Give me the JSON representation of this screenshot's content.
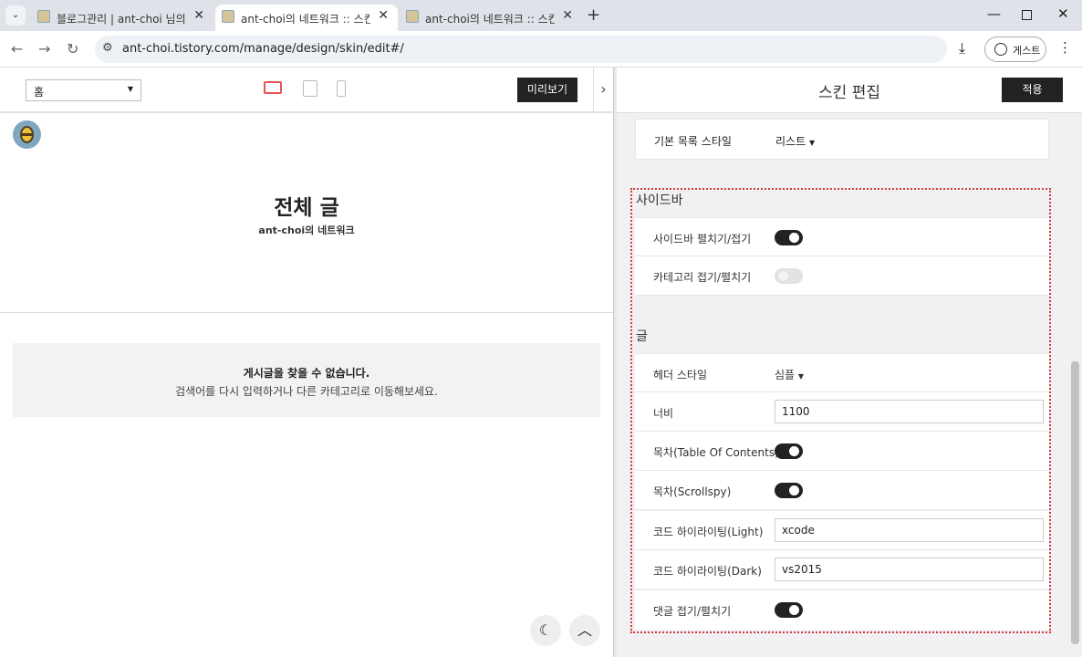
{
  "browser": {
    "tabs": [
      {
        "title": "블로그관리 | ant-choi 님의 블로그",
        "active": false
      },
      {
        "title": "ant-choi의 네트워크 :: 스킨편집",
        "active": true
      },
      {
        "title": "ant-choi의 네트워크 :: 스킨편집",
        "active": false
      }
    ],
    "url": "ant-choi.tistory.com/manage/design/skin/edit#/",
    "profile_label": "게스트"
  },
  "preview": {
    "page_select": "홈",
    "preview_button": "미리보기",
    "page_title": "전체 글",
    "blog_name": "ant-choi의 네트워크",
    "empty_title": "게시글을 찾을 수 없습니다.",
    "empty_desc": "검색어를 다시 입력하거나 다른 카테고리로 이동해보세요."
  },
  "editor": {
    "title": "스킨 편집",
    "apply_button": "적용",
    "list_style_label": "기본 목록 스타일",
    "list_style_value": "리스트",
    "sidebar_section": "사이드바",
    "sidebar_toggle_label": "사이드바 펼치기/접기",
    "sidebar_toggle_on": true,
    "category_toggle_label": "카테고리 접기/펼치기",
    "category_toggle_on": false,
    "post_section": "글",
    "header_style_label": "헤더 스타일",
    "header_style_value": "심플",
    "width_label": "너비",
    "width_value": "1100",
    "toc_label": "목차(Table Of Contents)",
    "toc_on": true,
    "scrollspy_label": "목차(Scrollspy)",
    "scrollspy_on": true,
    "code_light_label": "코드 하이라이팅(Light)",
    "code_light_value": "xcode",
    "code_dark_label": "코드 하이라이팅(Dark)",
    "code_dark_value": "vs2015",
    "comment_toggle_label": "댓글 접기/펼치기",
    "comment_toggle_on": true
  },
  "colors": {
    "accent": "#e55353",
    "highlight_border": "#d23a3a",
    "button": "#222222"
  }
}
